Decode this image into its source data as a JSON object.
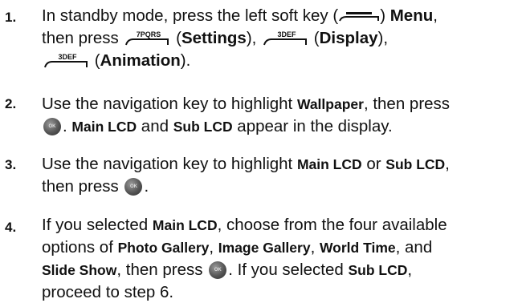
{
  "steps": [
    {
      "number": "1.",
      "line1_a": "In standby mode, press the left soft key (",
      "line1_b": ") ",
      "line1_menu": "Menu",
      "line1_c": ",",
      "line2_a": "then press",
      "key_7_label": "7PQRS",
      "line2_b": " (",
      "line2_settings": "Settings",
      "line2_c": "),",
      "key_3_label": "3DEF",
      "line2_d": " (",
      "line2_display": "Display",
      "line2_e": "),",
      "line3_a": " (",
      "line3_animation": "Animation",
      "line3_b": ")."
    },
    {
      "number": "2.",
      "line1_a": "Use the navigation key to highlight ",
      "line1_wallpaper": "Wallpaper",
      "line1_b": ", then press",
      "line2_a": ". ",
      "line2_main": "Main LCD",
      "line2_b": " and ",
      "line2_sub": "Sub LCD",
      "line2_c": " appear in the display."
    },
    {
      "number": "3.",
      "line1_a": "Use the navigation key to highlight ",
      "line1_main": "Main LCD",
      "line1_b": " or ",
      "line1_sub": "Sub LCD",
      "line1_c": ",",
      "line2_a": "then press",
      "line2_b": "."
    },
    {
      "number": "4.",
      "line1_a": "If you selected ",
      "line1_main": "Main LCD",
      "line1_b": ", choose from the four available",
      "line2_a": "options of ",
      "line2_photo": "Photo Gallery",
      "line2_b": ", ",
      "line2_image": "Image Gallery",
      "line2_c": ", ",
      "line2_world": "World Time",
      "line2_d": ", and",
      "line3_slide": "Slide Show",
      "line3_a": ", then press",
      "line3_b": ". If you selected ",
      "line3_sub": "Sub LCD",
      "line3_c": ",",
      "line4": "proceed to step 6."
    }
  ],
  "ok_key_label": "OK"
}
